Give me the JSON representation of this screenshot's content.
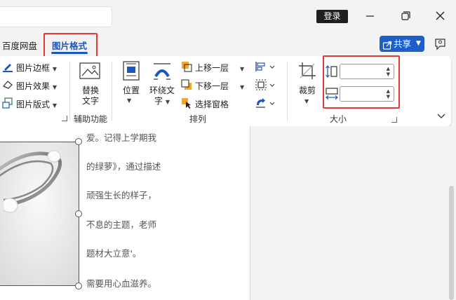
{
  "titlebar": {
    "login_label": "登录"
  },
  "tabs": {
    "baidu": "百度网盘",
    "picture_format": "图片格式"
  },
  "share": {
    "label": "共享"
  },
  "ribbon": {
    "style": {
      "border": "图片边框",
      "effect": "图片效果",
      "layout": "图片版式"
    },
    "accessibility": {
      "alt_text_line1": "替换",
      "alt_text_line2": "文字",
      "group": "辅助功能"
    },
    "arrange": {
      "position": "位置",
      "wrap_line1": "环绕文",
      "wrap_line2": "字",
      "bring_forward": "上移一层",
      "send_backward": "下移一层",
      "selection_pane": "选择窗格",
      "group": "排列"
    },
    "size": {
      "crop": "裁剪",
      "height_value": "",
      "width_value": "",
      "group": "大小"
    }
  },
  "document": {
    "lines": [
      "爱。记得上学期我",
      "的绿萝》，通过描述",
      "顽强生长的样子，",
      "不息的主题，老师",
      "题材大立意'。",
      "需要用心血滋养。"
    ]
  },
  "colors": {
    "accent": "#1a56c4",
    "highlight": "#e53935",
    "share_bg": "#1d5fc9"
  }
}
